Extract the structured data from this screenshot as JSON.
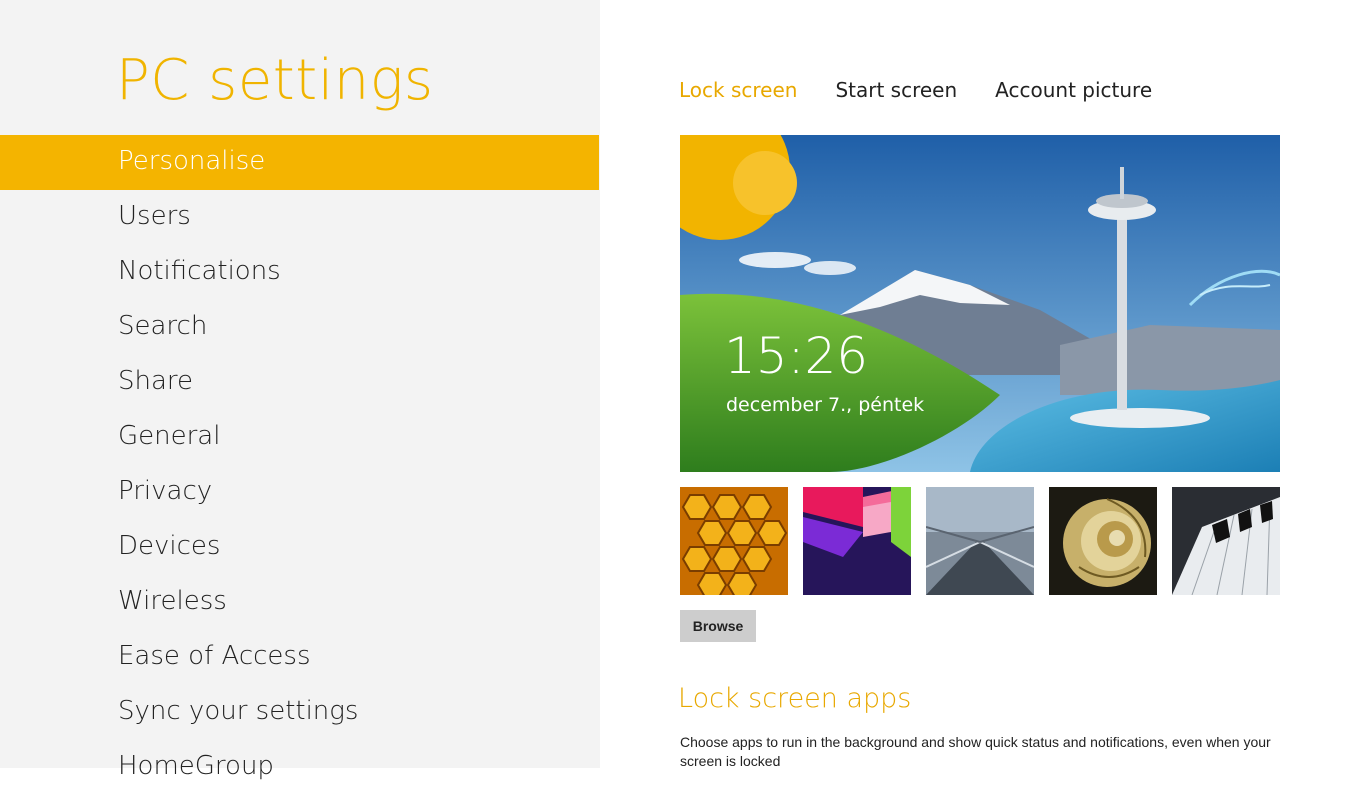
{
  "app": {
    "title": "PC settings"
  },
  "nav": {
    "items": [
      {
        "label": "Personalise"
      },
      {
        "label": "Users"
      },
      {
        "label": "Notifications"
      },
      {
        "label": "Search"
      },
      {
        "label": "Share"
      },
      {
        "label": "General"
      },
      {
        "label": "Privacy"
      },
      {
        "label": "Devices"
      },
      {
        "label": "Wireless"
      },
      {
        "label": "Ease of Access"
      },
      {
        "label": "Sync your settings"
      },
      {
        "label": "HomeGroup"
      }
    ],
    "active_index": 0
  },
  "tabs": [
    {
      "label": "Lock screen"
    },
    {
      "label": "Start screen"
    },
    {
      "label": "Account picture"
    }
  ],
  "preview": {
    "time": "15:26",
    "date": "december 7., péntek"
  },
  "thumbnails": [
    {
      "name": "honeycomb"
    },
    {
      "name": "colorful-cubes"
    },
    {
      "name": "subway-tunnel"
    },
    {
      "name": "nautilus-shell"
    },
    {
      "name": "piano-keys"
    }
  ],
  "browse_button": {
    "label": "Browse"
  },
  "lock_screen_apps": {
    "title": "Lock screen apps",
    "description": "Choose apps to run in the background and show quick status and notifications, even when your screen is locked"
  },
  "colors": {
    "accent": "#f4b400",
    "accent_text": "#e8a800",
    "left_pane_bg": "#f3f3f3"
  }
}
